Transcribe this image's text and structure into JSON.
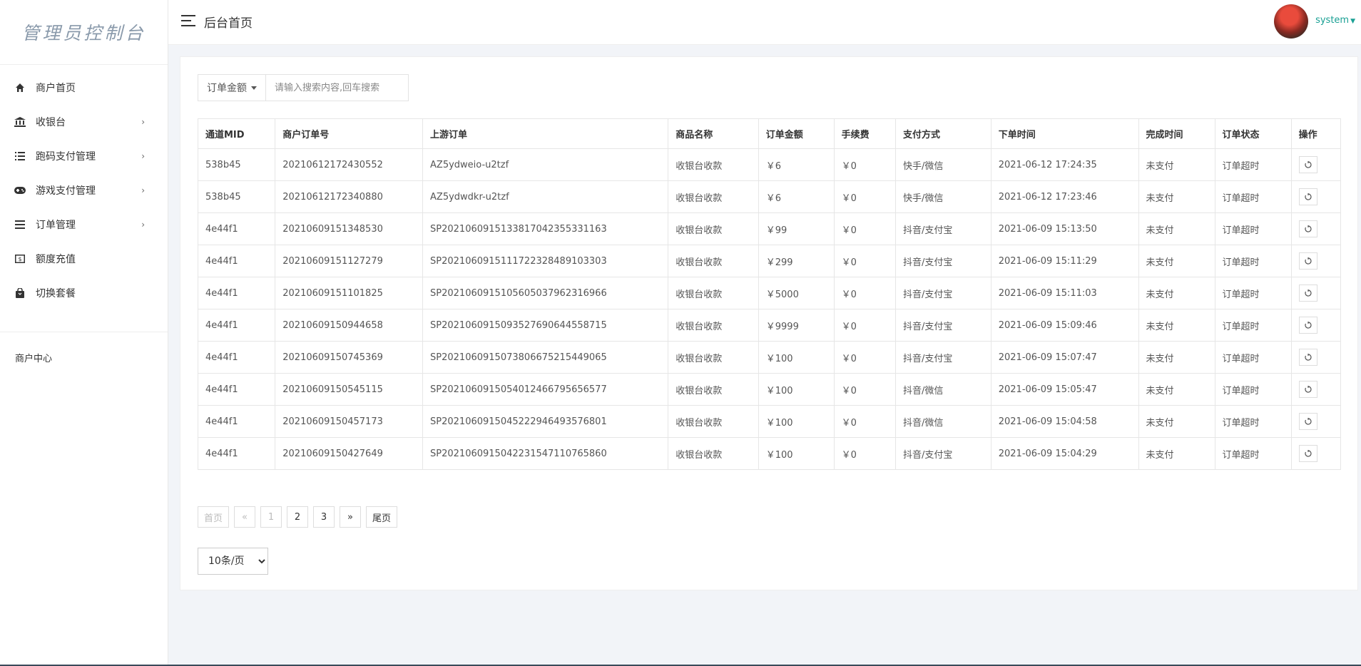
{
  "sidebar": {
    "brand": "管理员控制台",
    "items": [
      {
        "label": "商户首页",
        "icon": "home-icon",
        "has_arrow": false
      },
      {
        "label": "收银台",
        "icon": "bank-icon",
        "has_arrow": true
      },
      {
        "label": "跑码支付管理",
        "icon": "list-icon",
        "has_arrow": true
      },
      {
        "label": "游戏支付管理",
        "icon": "gamepad-icon",
        "has_arrow": true
      },
      {
        "label": "订单管理",
        "icon": "bars-icon",
        "has_arrow": true
      },
      {
        "label": "额度充值",
        "icon": "money-icon",
        "has_arrow": false
      },
      {
        "label": "切换套餐",
        "icon": "bag-icon",
        "has_arrow": false
      }
    ],
    "section": "商户中心",
    "arrow_glyph": "›"
  },
  "header": {
    "title": "后台首页",
    "user": "system"
  },
  "search": {
    "field": "订单金额",
    "placeholder": "请输入搜索内容,回车搜索"
  },
  "table": {
    "columns": [
      "通道MID",
      "商户订单号",
      "上游订单",
      "商品名称",
      "订单金额",
      "手续费",
      "支付方式",
      "下单时间",
      "完成时间",
      "订单状态",
      "操作"
    ],
    "rows": [
      [
        "538b45",
        "20210612172430552",
        "AZ5ydweio-u2tzf",
        "收银台收款",
        "￥6",
        "￥0",
        "快手/微信",
        "2021-06-12 17:24:35",
        "未支付",
        "订单超时"
      ],
      [
        "538b45",
        "20210612172340880",
        "AZ5ydwdkr-u2tzf",
        "收银台收款",
        "￥6",
        "￥0",
        "快手/微信",
        "2021-06-12 17:23:46",
        "未支付",
        "订单超时"
      ],
      [
        "4e44f1",
        "20210609151348530",
        "SP2021060915133817042355331163",
        "收银台收款",
        "￥99",
        "￥0",
        "抖音/支付宝",
        "2021-06-09 15:13:50",
        "未支付",
        "订单超时"
      ],
      [
        "4e44f1",
        "20210609151127279",
        "SP2021060915111722328489103303",
        "收银台收款",
        "￥299",
        "￥0",
        "抖音/支付宝",
        "2021-06-09 15:11:29",
        "未支付",
        "订单超时"
      ],
      [
        "4e44f1",
        "20210609151101825",
        "SP2021060915105605037962316966",
        "收银台收款",
        "￥5000",
        "￥0",
        "抖音/支付宝",
        "2021-06-09 15:11:03",
        "未支付",
        "订单超时"
      ],
      [
        "4e44f1",
        "20210609150944658",
        "SP2021060915093527690644558715",
        "收银台收款",
        "￥9999",
        "￥0",
        "抖音/支付宝",
        "2021-06-09 15:09:46",
        "未支付",
        "订单超时"
      ],
      [
        "4e44f1",
        "20210609150745369",
        "SP2021060915073806675215449065",
        "收银台收款",
        "￥100",
        "￥0",
        "抖音/支付宝",
        "2021-06-09 15:07:47",
        "未支付",
        "订单超时"
      ],
      [
        "4e44f1",
        "20210609150545115",
        "SP2021060915054012466795656577",
        "收银台收款",
        "￥100",
        "￥0",
        "抖音/微信",
        "2021-06-09 15:05:47",
        "未支付",
        "订单超时"
      ],
      [
        "4e44f1",
        "20210609150457173",
        "SP2021060915045222946493576801",
        "收银台收款",
        "￥100",
        "￥0",
        "抖音/微信",
        "2021-06-09 15:04:58",
        "未支付",
        "订单超时"
      ],
      [
        "4e44f1",
        "20210609150427649",
        "SP2021060915042231547110765860",
        "收银台收款",
        "￥100",
        "￥0",
        "抖音/支付宝",
        "2021-06-09 15:04:29",
        "未支付",
        "订单超时"
      ]
    ]
  },
  "pagination": {
    "first": "首页",
    "prev": "«",
    "pages": [
      "1",
      "2",
      "3"
    ],
    "next": "»",
    "last": "尾页",
    "page_size": "10条/页"
  },
  "colors": {
    "accent": "#1aa094",
    "unpaid": "#ff8c1a",
    "timeout": "#ff3b30"
  }
}
